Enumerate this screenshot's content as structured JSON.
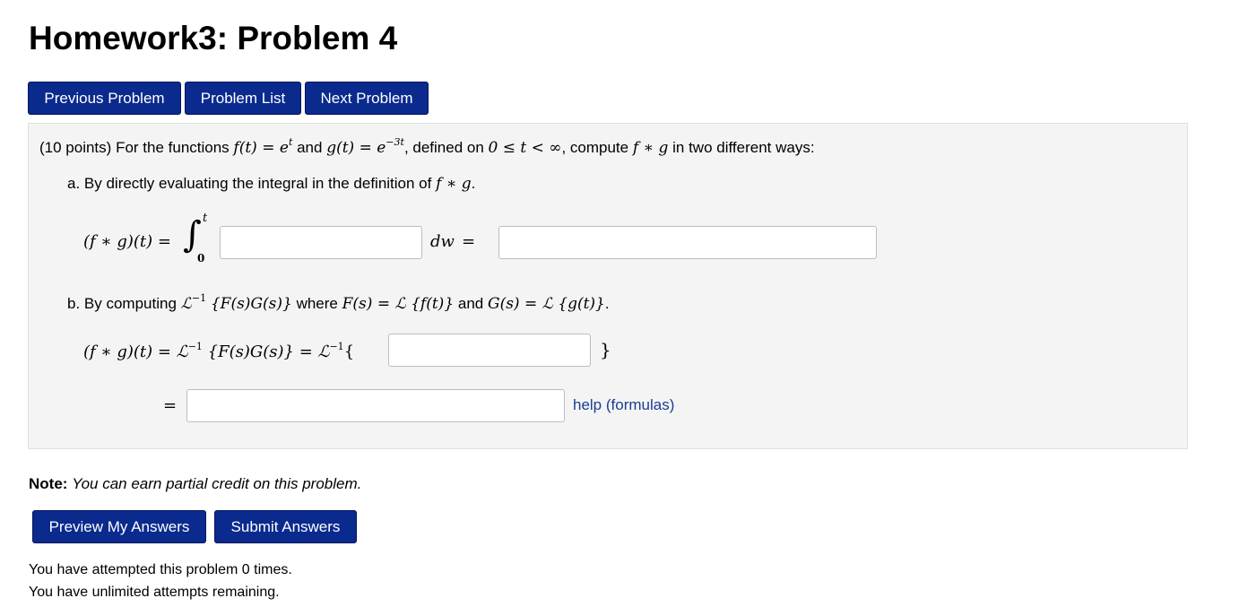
{
  "header": {
    "title": "Homework3: Problem 4"
  },
  "nav": {
    "previous": "Previous Problem",
    "list": "Problem List",
    "next": "Next Problem"
  },
  "problem": {
    "points": "(10 points)",
    "intro_a": "For the functions",
    "f_def": "f(t) = e",
    "f_exp": "t",
    "and": "and",
    "g_def": "g(t) = e",
    "g_exp": "−3t",
    "intro_b": ", defined on",
    "domain": "0 ≤ t < ∞",
    "intro_c": ", compute",
    "conv": "f ∗ g",
    "intro_d": "in two different ways:",
    "part_a": "a. By directly evaluating the integral in the definition of",
    "part_a_expr": "f ∗ g",
    "part_a_end": ".",
    "lhs": "(f ∗ g)(t) =",
    "int_sign": "∫",
    "int_upper": "t",
    "int_lower": "0",
    "dw": "dw",
    "eq": "=",
    "part_b_1": "b. By computing",
    "part_b_L": "ℒ",
    "part_b_inv": "−1",
    "part_b_arg": "{F(s)G(s)}",
    "part_b_2": "where",
    "part_b_F": "F(s) = ℒ {f(t)}",
    "part_b_and": "and",
    "part_b_G": "G(s) = ℒ {g(t)}",
    "part_b_end": ".",
    "line_b_lhs": "(f ∗ g)(t) = ℒ",
    "line_b_inv": "−1",
    "line_b_mid": "{F(s)G(s)} = ℒ",
    "line_b_inv2": "−1",
    "line_b_open": "{",
    "line_b_close": "}",
    "final_eq": "=",
    "help": "help (formulas)",
    "inputs": {
      "integrand": "",
      "integral_result": "",
      "product": "",
      "final": ""
    }
  },
  "note": {
    "label": "Note:",
    "text": "You can earn partial credit on this problem."
  },
  "actions": {
    "preview": "Preview My Answers",
    "submit": "Submit Answers"
  },
  "status": {
    "attempts": "You have attempted this problem 0 times.",
    "remaining": "You have unlimited attempts remaining."
  },
  "colors": {
    "button_bg": "#0a2a8e",
    "panel_bg": "#f4f4f4",
    "link": "#1a3e8f"
  }
}
